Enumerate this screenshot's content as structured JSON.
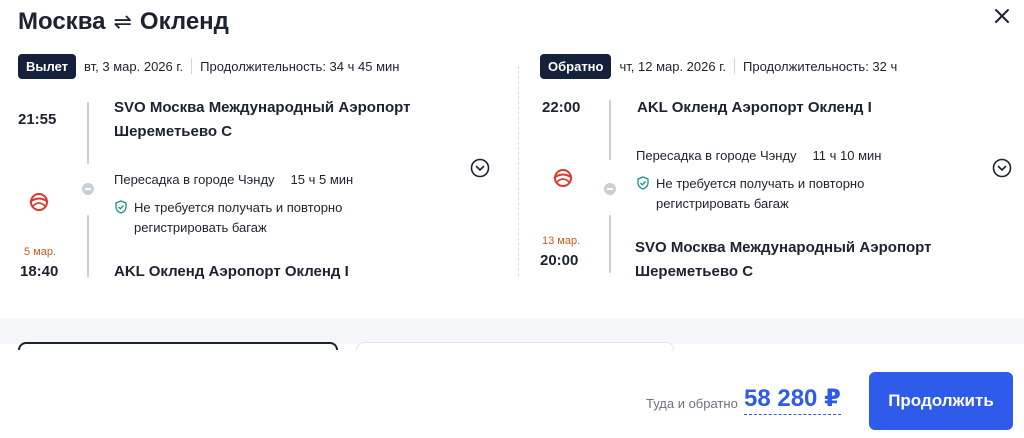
{
  "header": {
    "from_city": "Москва",
    "swap_symbol": "⇌",
    "to_city": "Окленд",
    "close_icon": "close-icon"
  },
  "outbound": {
    "badge": "Вылет",
    "date": "вт, 3 мар. 2026 г.",
    "duration": "Продолжительность: 34 ч 45 мин",
    "depart_time": "21:55",
    "depart_airport_line1": "SVO Москва Международный Аэропорт",
    "depart_airport_line2": "Шереметьево C",
    "transfer_label": "Пересадка в городе Чэнду",
    "transfer_duration": "15 ч 5 мин",
    "baggage_note_line1": "Не требуется получать и повторно",
    "baggage_note_line2": "регистрировать багаж",
    "arrive_date": "5 мар.",
    "arrive_time": "18:40",
    "arrive_airport": "AKL Окленд Аэропорт Окленд I",
    "airline_icon": "sichuan-airlines-logo",
    "expand_icon": "chevron-down-circle-icon"
  },
  "return": {
    "badge": "Обратно",
    "date": "чт, 12 мар. 2026 г.",
    "duration": "Продолжительность: 32 ч",
    "depart_time": "22:00",
    "depart_airport": "AKL Окленд Аэропорт Окленд I",
    "transfer_label": "Пересадка в городе Чэнду",
    "transfer_duration": "11 ч 10 мин",
    "baggage_note_line1": "Не требуется получать и повторно",
    "baggage_note_line2": "регистрировать багаж",
    "arrive_date": "13 мар.",
    "arrive_time": "20:00",
    "arrive_airport_line1": "SVO Москва Международный Аэропорт",
    "arrive_airport_line2": "Шереметьево C",
    "airline_icon": "sichuan-airlines-logo",
    "expand_icon": "chevron-down-circle-icon"
  },
  "footer": {
    "price_label": "Туда и обратно",
    "price": "58 280 ₽",
    "continue_label": "Продолжить"
  },
  "colors": {
    "accent": "#2f5bea",
    "badge_bg": "#15213a",
    "arrival_date": "#c65a1e",
    "airline_red": "#d83a2e"
  }
}
